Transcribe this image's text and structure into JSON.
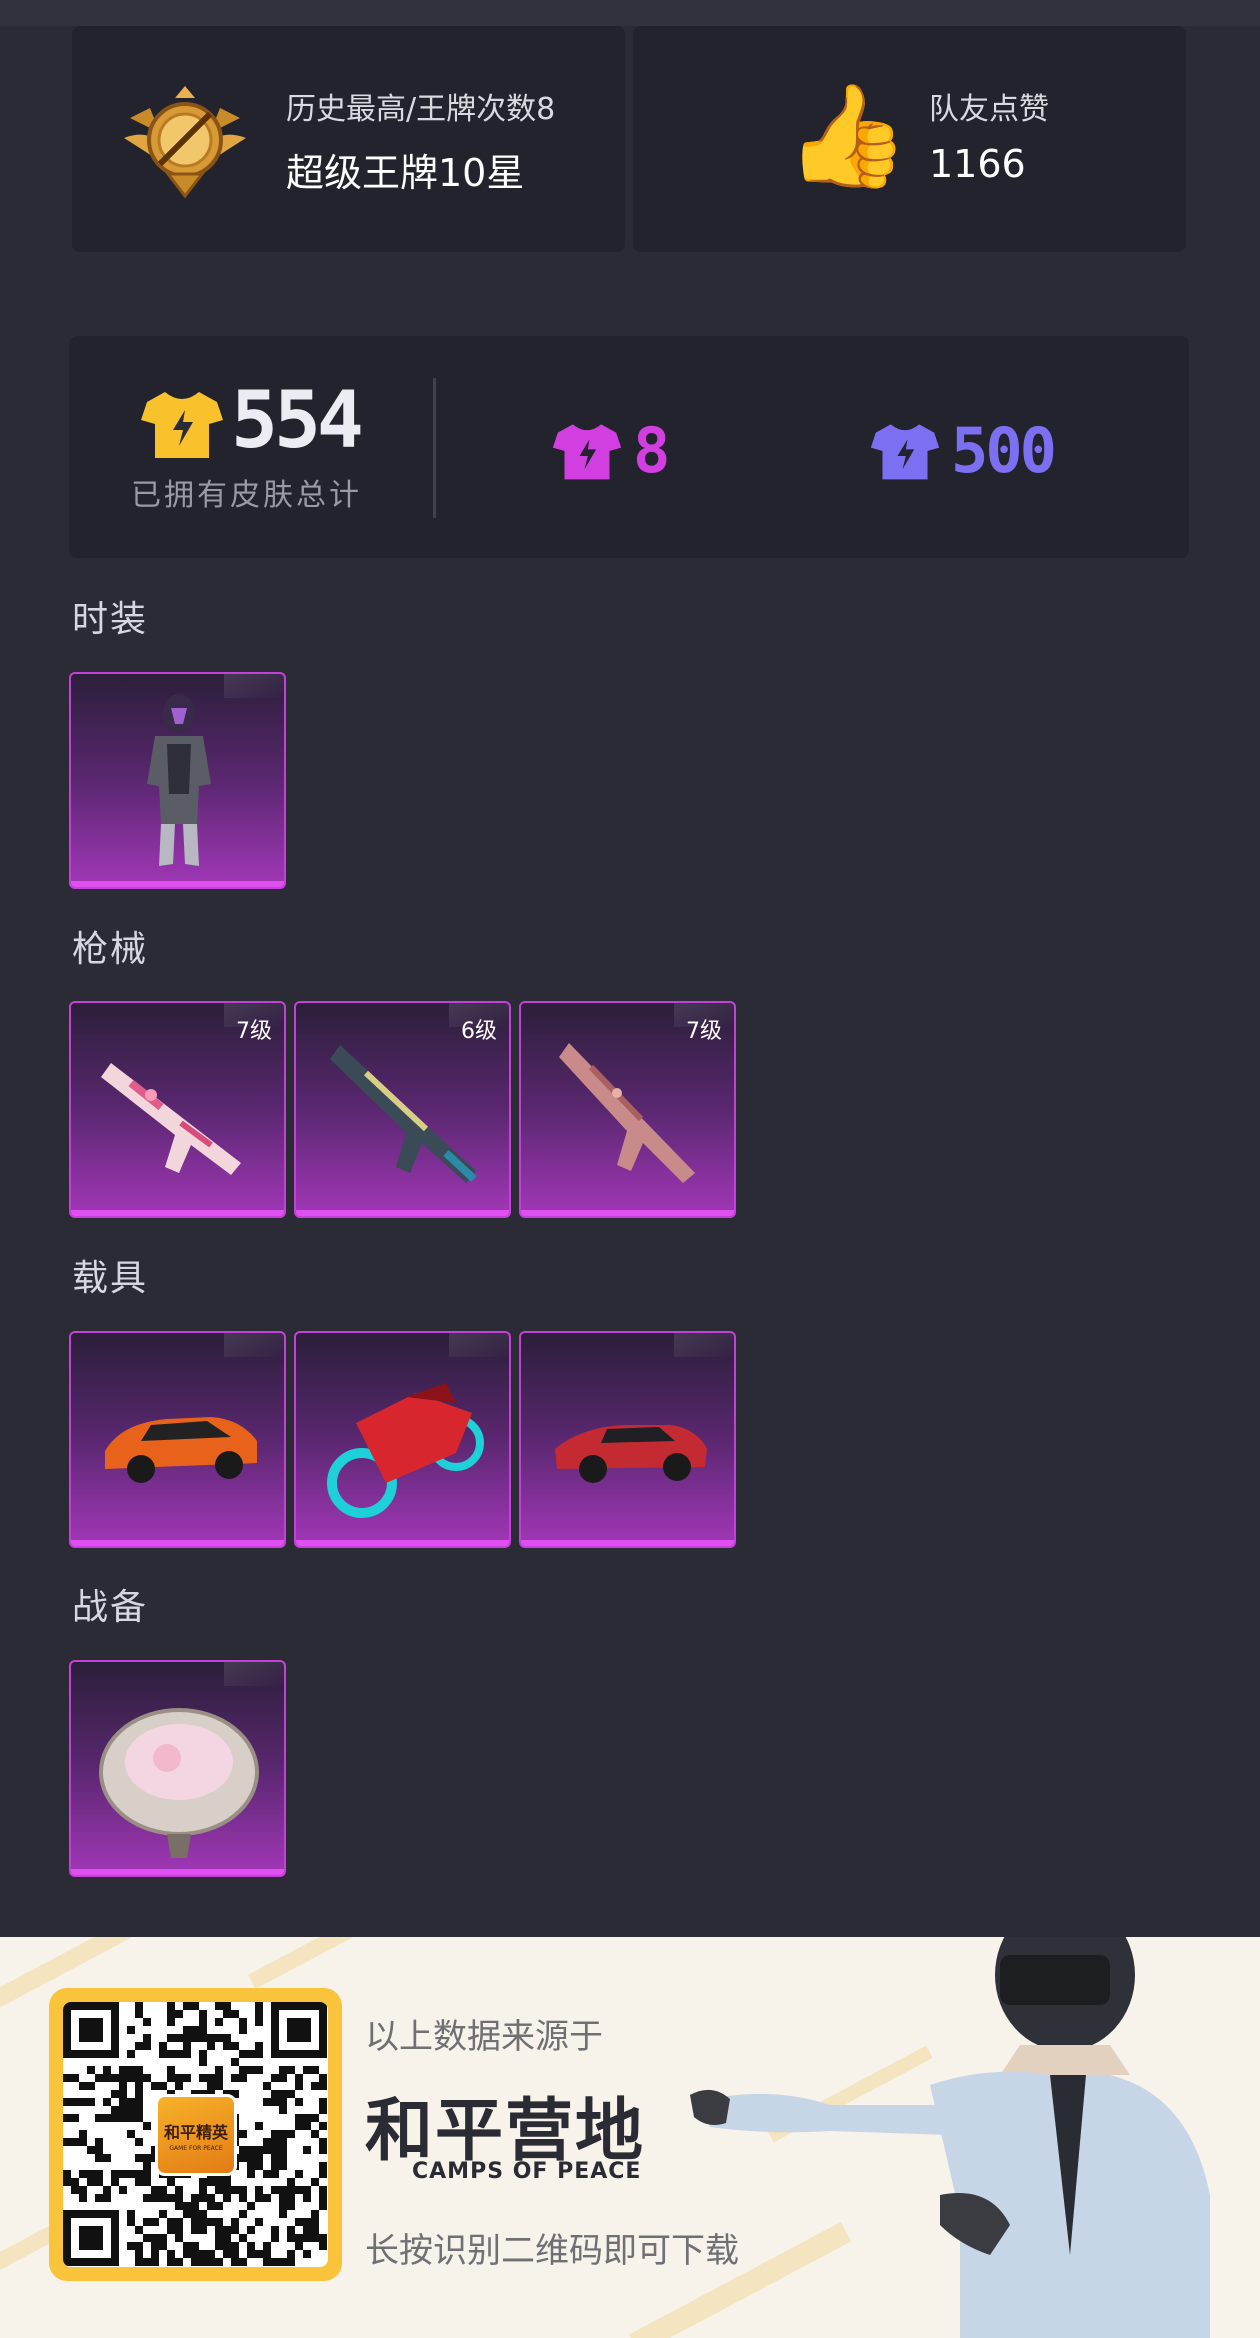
{
  "rank_card": {
    "subtitle": "历史最高/王牌次数8",
    "title": "超级王牌10星",
    "emblem_icon": "ace-rank-emblem-icon"
  },
  "likes_card": {
    "label": "队友点赞",
    "value": "1166",
    "icon": "thumbs-up-icon"
  },
  "skins_card": {
    "total_value": "554",
    "total_label": "已拥有皮肤总计",
    "stats": [
      {
        "value": "8",
        "color": "#d23fe0",
        "icon": "tshirt-pink-icon"
      },
      {
        "value": "500",
        "color": "#7d6ff2",
        "icon": "tshirt-purple-icon"
      }
    ],
    "total_icon_color": "#f9c22c"
  },
  "sections": [
    {
      "title": "时装",
      "items": [
        {
          "name": "outfit",
          "level": ""
        }
      ]
    },
    {
      "title": "枪械",
      "items": [
        {
          "name": "rifle-1",
          "level": "7级"
        },
        {
          "name": "rifle-2",
          "level": "6级"
        },
        {
          "name": "rifle-3",
          "level": "7级"
        }
      ]
    },
    {
      "title": "载具",
      "items": [
        {
          "name": "car-orange",
          "level": ""
        },
        {
          "name": "motorcycle-red",
          "level": ""
        },
        {
          "name": "car-red",
          "level": ""
        }
      ]
    },
    {
      "title": "战备",
      "items": [
        {
          "name": "pan",
          "level": ""
        }
      ]
    }
  ],
  "footer": {
    "source_text": "以上数据来源于",
    "brand_cn": "和平营地",
    "brand_en": "CAMPS OF PEACE",
    "hint_text": "长按识别二维码即可下载",
    "qr_badge_title": "和平精英",
    "qr_badge_sub": "GAME FOR PEACE",
    "qr_frame_color": "#f9c33b"
  },
  "colors": {
    "background": "#2a2b35",
    "card": "#22232c",
    "item_border": "#c540d6"
  }
}
